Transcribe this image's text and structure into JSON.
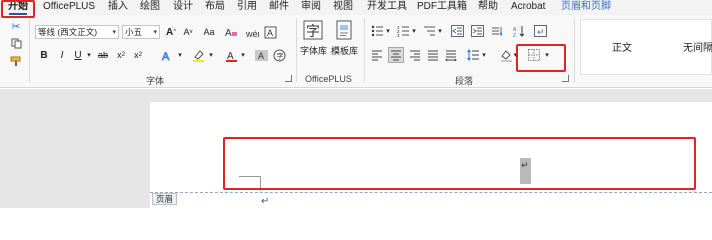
{
  "tabs": [
    {
      "label": "开始",
      "active": true
    },
    {
      "label": "OfficePLUS"
    },
    {
      "label": "插入"
    },
    {
      "label": "绘图"
    },
    {
      "label": "设计"
    },
    {
      "label": "布局"
    },
    {
      "label": "引用"
    },
    {
      "label": "邮件"
    },
    {
      "label": "审阅"
    },
    {
      "label": "视图"
    },
    {
      "label": "开发工具"
    },
    {
      "label": "PDF工具箱"
    },
    {
      "label": "帮助"
    },
    {
      "label": "Acrobat"
    },
    {
      "label": "页眉和页脚",
      "contextual": true
    }
  ],
  "font": {
    "name": "等线 (西文正文)",
    "size": "小五",
    "group_label": "字体"
  },
  "officeplus": {
    "font_lib": "字体库",
    "template_lib": "模板库",
    "group_label": "OfficePLUS"
  },
  "paragraph": {
    "group_label": "段落"
  },
  "styles": [
    {
      "label": "正文"
    },
    {
      "label": "无间隔"
    }
  ],
  "document": {
    "header_label": "页眉",
    "paragraph_mark": "↵"
  },
  "colors": {
    "highlight_box": "#e02424",
    "contextual_tab": "#3c6fbe",
    "accent": "#2b579a"
  }
}
